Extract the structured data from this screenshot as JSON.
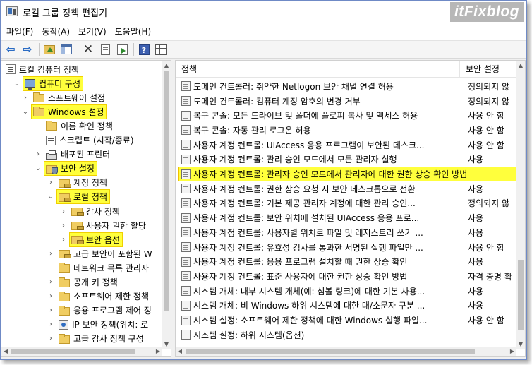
{
  "window": {
    "title": "로컬 그룹 정책 편집기",
    "watermark": "itFixblog"
  },
  "menu": [
    "파일(F)",
    "동작(A)",
    "보기(V)",
    "도움말(H)"
  ],
  "toolbar_icons": [
    "back-arrow-icon",
    "forward-arrow-icon",
    "up-folder-icon",
    "show-hide-tree-icon",
    "delete-icon",
    "properties-icon",
    "export-list-icon",
    "help-icon",
    "grid-view-icon"
  ],
  "tree": [
    {
      "label": "로컬 컴퓨터 정책",
      "icon": "computer-policy-icon",
      "level": 0,
      "twisty": ""
    },
    {
      "label": "컴퓨터 구성",
      "icon": "computer-icon",
      "level": 1,
      "twisty": "open",
      "highlight": true
    },
    {
      "label": "소프트웨어 설정",
      "icon": "folder-icon",
      "level": 2,
      "twisty": "closed"
    },
    {
      "label": "Windows 설정",
      "icon": "folder-icon",
      "level": 2,
      "twisty": "open",
      "highlight": true
    },
    {
      "label": "이름 확인 정책",
      "icon": "folder-icon",
      "level": 3,
      "twisty": ""
    },
    {
      "label": "스크립트 (시작/종료)",
      "icon": "script-icon",
      "level": 3,
      "twisty": ""
    },
    {
      "label": "배포된 프린터",
      "icon": "printer-icon",
      "level": 3,
      "twisty": "closed"
    },
    {
      "label": "보안 설정",
      "icon": "security-icon",
      "level": 3,
      "twisty": "open",
      "highlight": true
    },
    {
      "label": "계정 정책",
      "icon": "security-folder-icon",
      "level": 4,
      "twisty": "closed"
    },
    {
      "label": "로컬 정책",
      "icon": "security-folder-icon",
      "level": 4,
      "twisty": "open",
      "highlight": true
    },
    {
      "label": "감사 정책",
      "icon": "security-folder-icon",
      "level": 5,
      "twisty": "closed"
    },
    {
      "label": "사용자 권한 할당",
      "icon": "security-folder-icon",
      "level": 5,
      "twisty": "closed"
    },
    {
      "label": "보안 옵션",
      "icon": "security-folder-icon",
      "level": 5,
      "twisty": "closed",
      "highlight": true
    },
    {
      "label": "고급 보안이 포함된 W",
      "icon": "security-folder-icon",
      "level": 4,
      "twisty": "closed"
    },
    {
      "label": "네트워크 목록 관리자",
      "icon": "folder-icon",
      "level": 4,
      "twisty": ""
    },
    {
      "label": "공개 키 정책",
      "icon": "folder-icon",
      "level": 4,
      "twisty": "closed"
    },
    {
      "label": "소프트웨어 제한 정책",
      "icon": "folder-icon",
      "level": 4,
      "twisty": "closed"
    },
    {
      "label": "응용 프로그램 제어 정",
      "icon": "folder-icon",
      "level": 4,
      "twisty": "closed"
    },
    {
      "label": "IP 보안 정책(위치: 로",
      "icon": "ip-security-icon",
      "level": 4,
      "twisty": "closed"
    },
    {
      "label": "고급 감사 정책 구성",
      "icon": "folder-icon",
      "level": 4,
      "twisty": "closed"
    }
  ],
  "list": {
    "col_policy": "정책",
    "col_setting": "보안 설정",
    "rows": [
      {
        "name": "도메인 컨트롤러: 취약한 Netlogon 보안 채널 연결 허용",
        "value": "정의되지 않"
      },
      {
        "name": "도메인 컨트롤러: 컴퓨터 계정 암호의 변경 거부",
        "value": "정의되지 않"
      },
      {
        "name": "복구 콘솔: 모든 드라이브 및 폴더에 플로피 복사 및 액세스 허용",
        "value": "사용 안 함"
      },
      {
        "name": "복구 콘솔: 자동 관리 로그온 허용",
        "value": "사용 안 함"
      },
      {
        "name": "사용자 계정 컨트롤: UIAccess 응용 프로그램이 보안된 데스크...",
        "value": "사용 안 함"
      },
      {
        "name": "사용자 계정 컨트롤: 관리 승인 모드에서 모든 관리자 실행",
        "value": "사용"
      },
      {
        "name": "사용자 계정 컨트롤: 관리자 승인 모드에서 관리자에 대한 권한 상승 확인 방법",
        "value": "",
        "selected": true
      },
      {
        "name": "사용자 계정 컨트롤: 권한 상승 요청 시 보안 데스크톱으로 전환",
        "value": "사용"
      },
      {
        "name": "사용자 계정 컨트롤: 기본 제공 관리자 계정에 대한 관리 승인...",
        "value": "정의되지 않"
      },
      {
        "name": "사용자 계정 컨트롤: 보안 위치에 설치된 UIAccess 응용 프로...",
        "value": "사용"
      },
      {
        "name": "사용자 계정 컨트롤: 사용자별 위치로 파일 및 레지스트리 쓰기 ...",
        "value": "사용"
      },
      {
        "name": "사용자 계정 컨트롤: 유효성 검사를 통과한 서명된 실행 파일만 ...",
        "value": "사용 안 함"
      },
      {
        "name": "사용자 계정 컨트롤: 응용 프로그램 설치할 때 권한 상승 확인",
        "value": "사용"
      },
      {
        "name": "사용자 계정 컨트롤: 표준 사용자에 대한 권한 상승 확인 방법",
        "value": "자격 증명 확"
      },
      {
        "name": "시스템 개체: 내부 시스템 개체(예: 심볼 링크)에 대한 기본 사용...",
        "value": "사용"
      },
      {
        "name": "시스템 개체: 비 Windows 하위 시스템에 대한 대/소문자 구분 ...",
        "value": "사용"
      },
      {
        "name": "시스템 설정: 소프트웨어 제한 정책에 대한 Windows 실행 파일...",
        "value": "사용 안 함"
      },
      {
        "name": "시스템 설정: 하위 시스템(옵션)",
        "value": ""
      }
    ]
  }
}
